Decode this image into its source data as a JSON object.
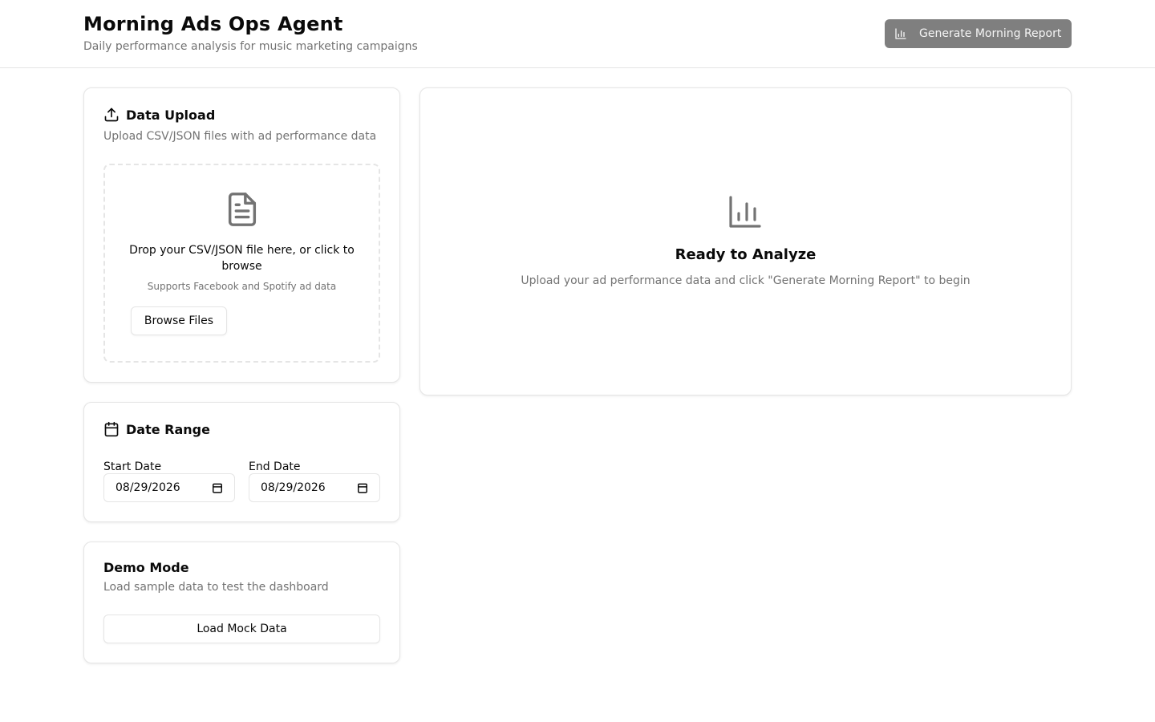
{
  "header": {
    "title": "Morning Ads Ops Agent",
    "subtitle": "Daily performance analysis for music marketing campaigns",
    "generate_label": "Generate Morning Report"
  },
  "upload": {
    "title": "Data Upload",
    "description": "Upload CSV/JSON files with ad performance data",
    "dropzone_text": "Drop your CSV/JSON file here, or click to browse",
    "dropzone_sub": "Supports Facebook and Spotify ad data",
    "browse_label": "Browse Files"
  },
  "date_range": {
    "title": "Date Range",
    "start_label": "Start Date",
    "start_value": "08/29/2026",
    "end_label": "End Date",
    "end_value": "08/29/2026"
  },
  "demo": {
    "title": "Demo Mode",
    "description": "Load sample data to test the dashboard",
    "button_label": "Load Mock Data"
  },
  "ready": {
    "title": "Ready to Analyze",
    "description": "Upload your ad performance data and click \"Generate Morning Report\" to begin"
  },
  "icons": {
    "generate": "bar-chart-icon",
    "upload": "upload-icon",
    "file": "file-text-icon",
    "calendar": "calendar-icon",
    "ready": "bar-chart-icon"
  },
  "colors": {
    "primary_disabled": "#7f7f7f",
    "border": "#e5e5e5",
    "muted_text": "#737373",
    "text": "#0a0a0a"
  }
}
